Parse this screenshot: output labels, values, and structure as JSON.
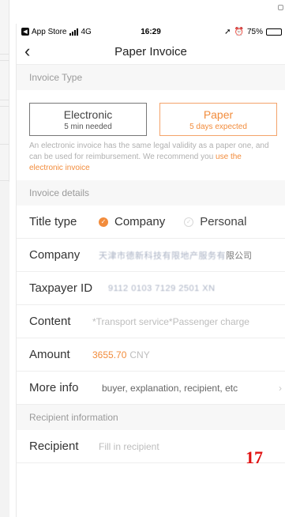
{
  "status_bar": {
    "back_app": "App Store",
    "network": "4G",
    "time": "16:29",
    "battery": "75%",
    "battery_level": 0.75
  },
  "nav": {
    "title": "Paper Invoice"
  },
  "invoice_type": {
    "header": "Invoice Type",
    "options": [
      {
        "name": "Electronic",
        "sub": "5 min needed",
        "selected": false
      },
      {
        "name": "Paper",
        "sub": "5 days expected",
        "selected": true
      }
    ],
    "note": "An electronic invoice has the same legal validity as a paper one, and can be used for reimbursement. We recommend you",
    "note_link": "use the electronic invoice"
  },
  "details": {
    "header": "Invoice details",
    "title_type_label": "Title type",
    "title_options": [
      {
        "label": "Company",
        "selected": true
      },
      {
        "label": "Personal",
        "selected": false
      }
    ],
    "company_label": "Company",
    "company_blurred": "天津市德新科技有限地产服务有",
    "company_suffix": "限公司",
    "taxpayer_label": "Taxpayer ID",
    "taxpayer_blurred": "9112 0103 7129 2501 XN",
    "content_label": "Content",
    "content_value": "*Transport service*Passenger charge",
    "amount_label": "Amount",
    "amount_value": "3655.70",
    "amount_unit": "CNY",
    "more_label": "More info",
    "more_value": "buyer, explanation, recipient, etc"
  },
  "recipient": {
    "header": "Recipient information",
    "label": "Recipient",
    "placeholder": "Fill in recipient"
  },
  "badge": "17",
  "colors": {
    "accent": "#f28c3c",
    "badge": "#e01010",
    "section_bg": "#f7f7f7"
  }
}
